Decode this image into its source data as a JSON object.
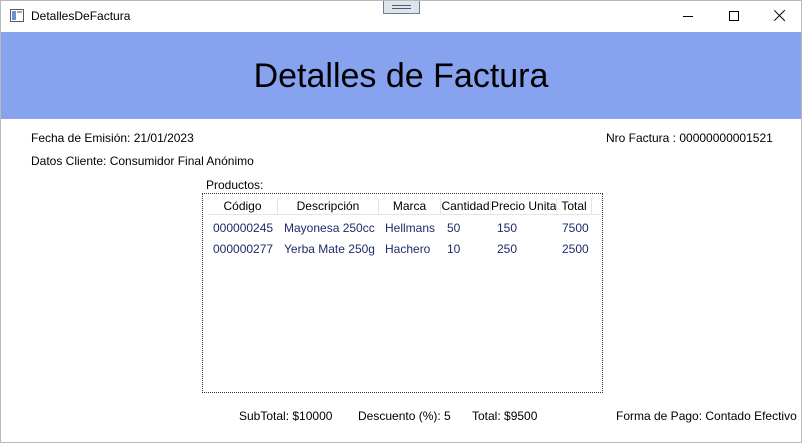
{
  "window": {
    "title": "DetallesDeFactura",
    "icons": {
      "app": "window-app-icon",
      "minimize": "minimize-icon",
      "maximize": "maximize-icon",
      "close": "close-icon"
    }
  },
  "header": {
    "title": "Detalles de Factura",
    "background": "#87a2ef"
  },
  "info": {
    "fecha": "Fecha de Emisión: 21/01/2023",
    "nro_factura": "Nro Factura : 00000000001521",
    "cliente": "Datos Cliente: Consumidor Final Anónimo",
    "productos_label": "Productos:"
  },
  "table": {
    "columns": [
      "Código",
      "Descripción",
      "Marca",
      "Cantidad",
      "Precio Unitario",
      "Total"
    ],
    "rows": [
      [
        "000000245",
        "Mayonesa 250cc",
        "Hellmans",
        "50",
        "150",
        "7500"
      ],
      [
        "000000277",
        "Yerba Mate 250g",
        "Hachero",
        "10",
        "250",
        "2500"
      ]
    ],
    "cell_color": "#1e2b69"
  },
  "footer": {
    "subtotal": "SubTotal: $10000",
    "descuento": "Descuento (%): 5",
    "total": "Total: $9500",
    "forma_pago": "Forma de Pago: Contado Efectivo"
  }
}
